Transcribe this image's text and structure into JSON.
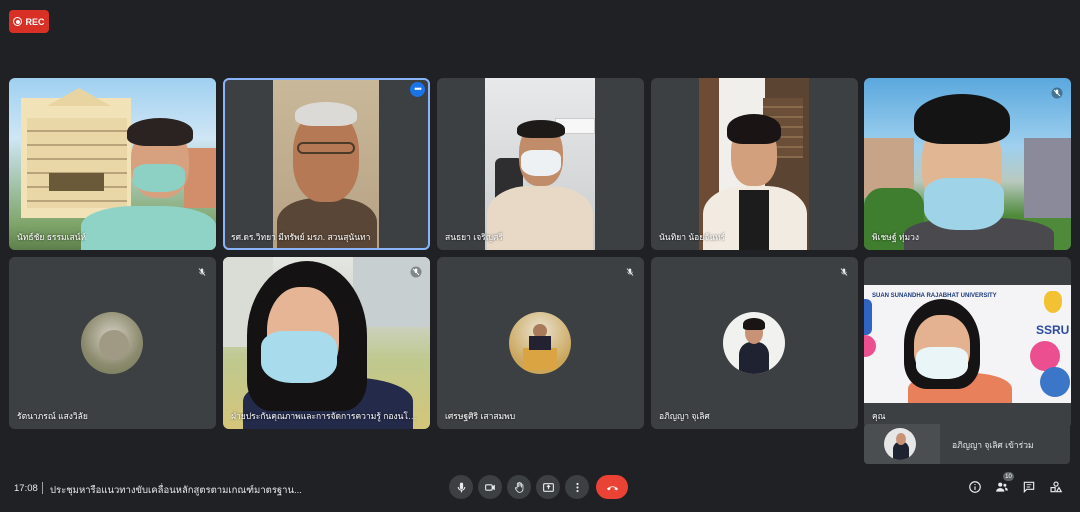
{
  "recording": {
    "label": "REC"
  },
  "participants": [
    {
      "name": "นัทธ์ชัย ธรรมเสน์ห์"
    },
    {
      "name": "รศ.ดร.วิทยา มีทรัพย์ มรภ. สวนสุนันทา"
    },
    {
      "name": "สนธยา เจริญศรี"
    },
    {
      "name": "นันทิยา น้อยจันทร์"
    },
    {
      "name": "พิเชษฐ์ ทุ่มวง"
    },
    {
      "name": "รัตนาภรณ์ แสงวิลัย"
    },
    {
      "name": "ฝ่ายประกันคุณภาพและการจัดการความรู้ กองนโยบายแ..."
    },
    {
      "name": "เศรษฐศิริ เสาสมพบ"
    },
    {
      "name": "อภิญญา จุเลิศ"
    },
    {
      "name": "คุณ",
      "banner": "SUAN SUNANDHA RAJABHAT UNIVERSITY",
      "logo_text": "SSRU"
    }
  ],
  "join_notice": {
    "text": "อภิญญา จุเลิศ เข้าร่วม"
  },
  "bottom_bar": {
    "time": "17:08",
    "meeting_title": "ประชุมหารือแนวทางขับเคลื่อนหลักสูตรตามเกณฑ์มาตรฐาน...",
    "people_count": "10",
    "controls": [
      "mic-icon",
      "camera-icon",
      "raise-hand-icon",
      "present-icon",
      "more-options-icon",
      "end-call-icon"
    ],
    "right_controls": [
      "info-icon",
      "people-icon",
      "chat-icon",
      "activities-icon"
    ]
  },
  "colors": {
    "background": "#202124",
    "tile": "#3c4043",
    "active_outline": "#8ab4f8",
    "end_call": "#ea4335",
    "rec": "#d93025"
  }
}
